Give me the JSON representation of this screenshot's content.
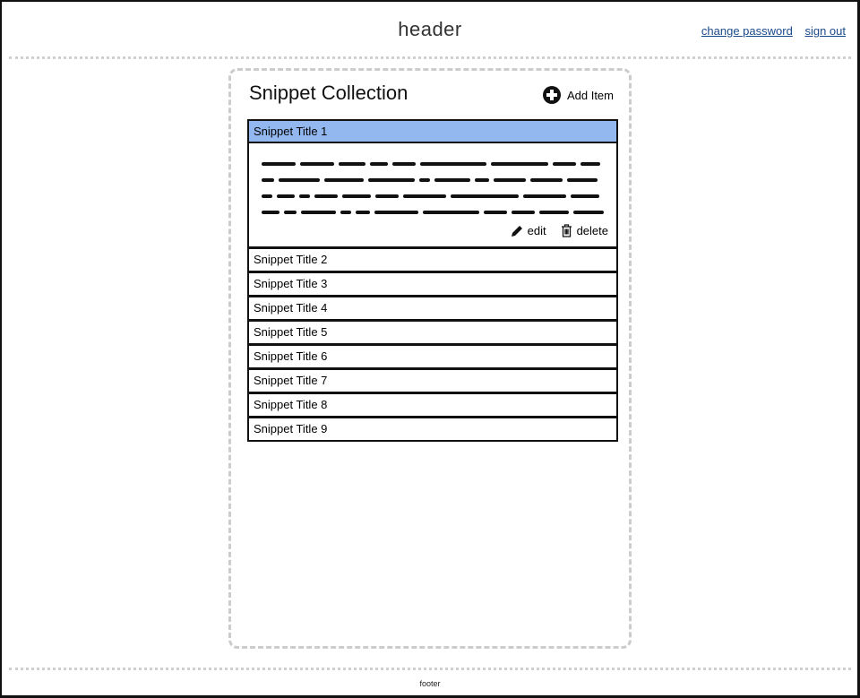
{
  "header": {
    "title": "header",
    "links": {
      "change_password": "change password",
      "sign_out": "sign out"
    },
    "link_color": "#1b4a8a"
  },
  "panel": {
    "title": "Snippet Collection",
    "add_item_label": "Add Item",
    "add_item_icon": "plus-circle-icon"
  },
  "snippets": [
    {
      "title": "Snippet Title 1",
      "selected": true,
      "expanded": true,
      "body": "[scribbled placeholder text — 4 lines]"
    },
    {
      "title": "Snippet Title 2"
    },
    {
      "title": "Snippet Title 3"
    },
    {
      "title": "Snippet Title 4"
    },
    {
      "title": "Snippet Title 5"
    },
    {
      "title": "Snippet Title 6"
    },
    {
      "title": "Snippet Title 7"
    },
    {
      "title": "Snippet Title 8"
    },
    {
      "title": "Snippet Title 9"
    }
  ],
  "actions": {
    "edit": "edit",
    "delete": "delete",
    "edit_icon": "pencil-icon",
    "delete_icon": "trash-icon"
  },
  "selected_color": "#93b8ef",
  "footer": {
    "text": "footer"
  }
}
